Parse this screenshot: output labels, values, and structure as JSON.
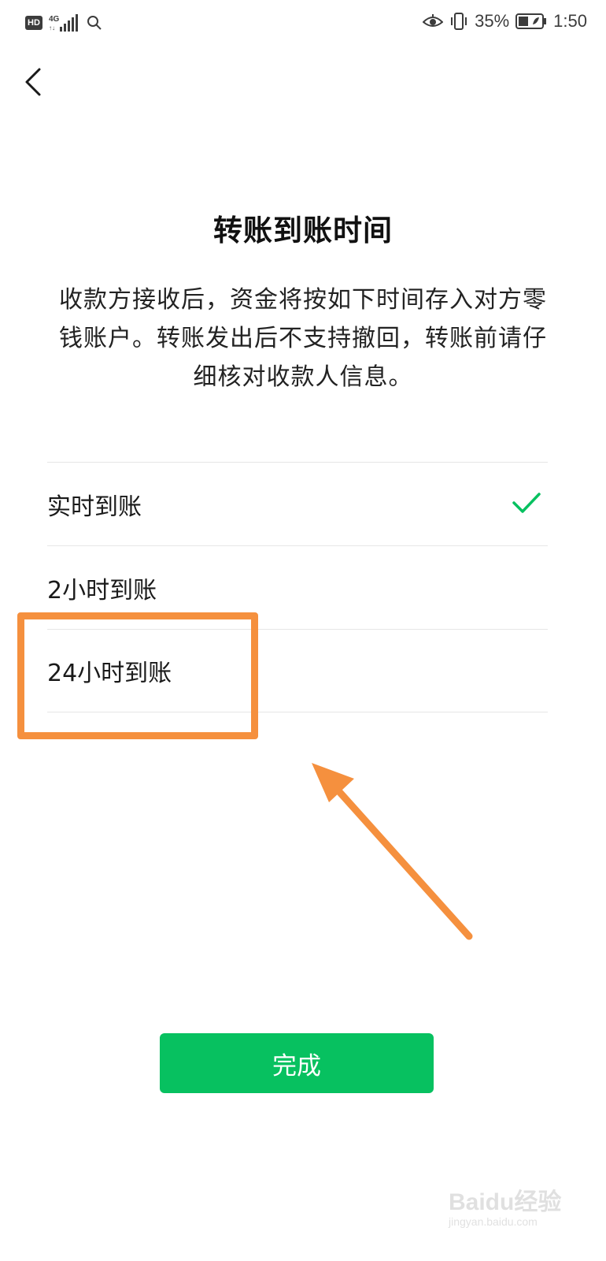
{
  "status_bar": {
    "hd": "HD",
    "network": "4G",
    "battery": "35%",
    "time": "1:50"
  },
  "header": {
    "back_icon": "chevron-left-icon"
  },
  "title": "转账到账时间",
  "description": "收款方接收后，资金将按如下时间存入对方零钱账户。转账发出后不支持撤回，转账前请仔细核对收款人信息。",
  "options": [
    {
      "label": "实时到账",
      "selected": true
    },
    {
      "label": "2小时到账",
      "selected": false
    },
    {
      "label": "24小时到账",
      "selected": false
    }
  ],
  "done_button": "完成",
  "colors": {
    "accent": "#07c160",
    "highlight": "#f5903e"
  },
  "watermark": {
    "text": "Baidu经验",
    "url": "jingyan.baidu.com"
  }
}
